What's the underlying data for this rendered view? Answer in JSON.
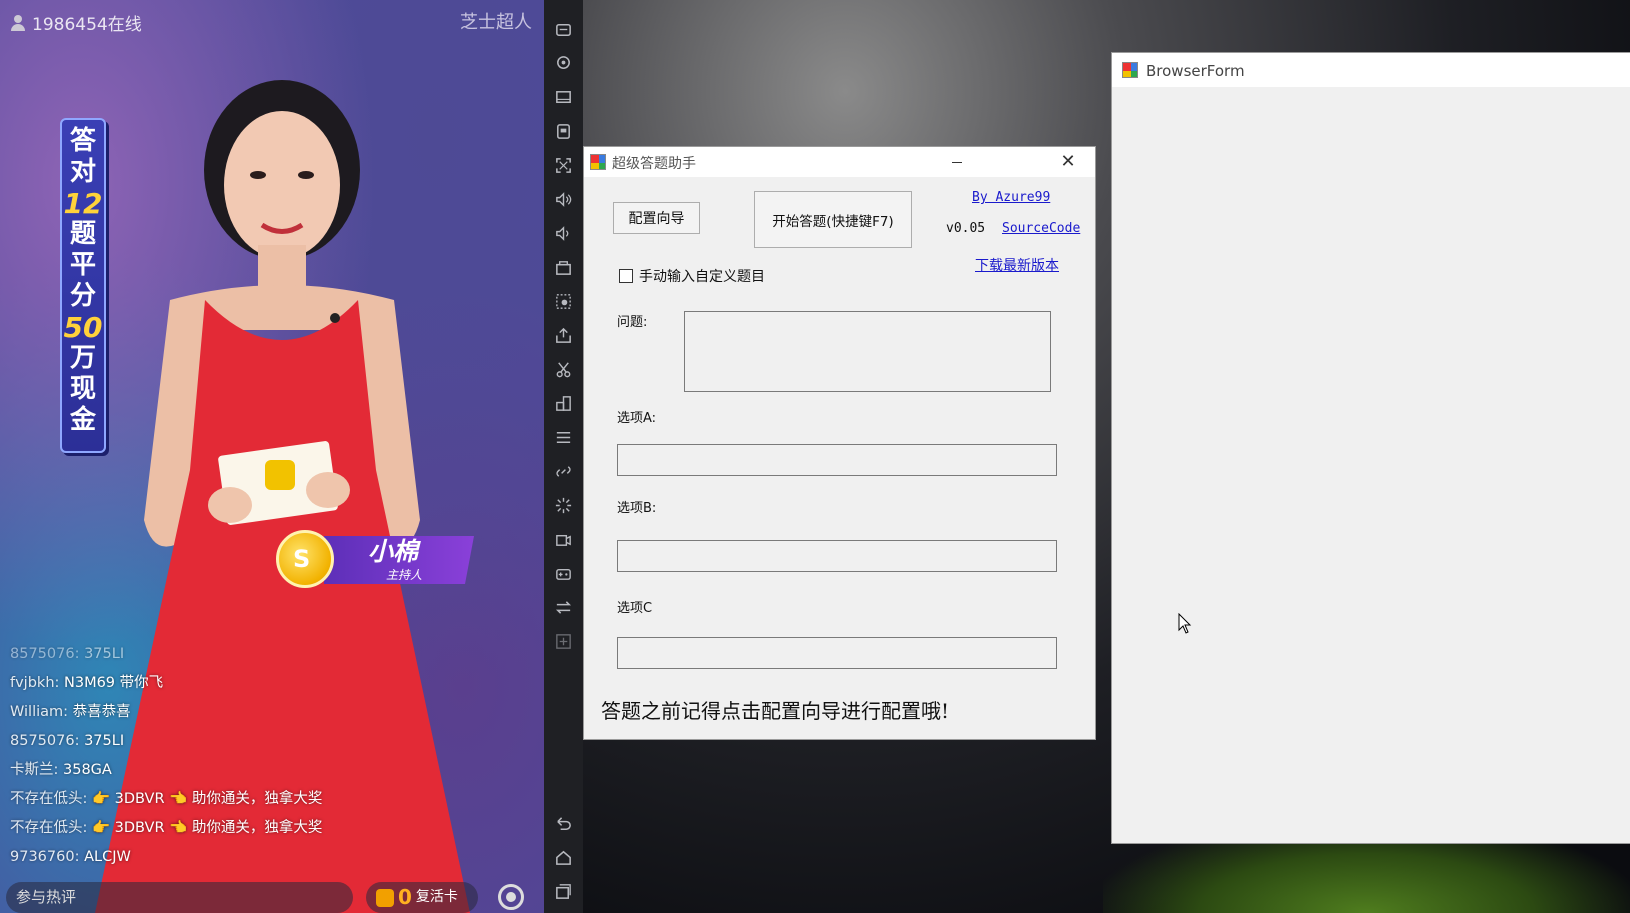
{
  "stream": {
    "viewers": "1986454在线",
    "brand": "芝士超人",
    "promo_chars": [
      "答",
      "对",
      "12",
      "题",
      "平",
      "分",
      "50",
      "万",
      "现",
      "金"
    ],
    "host_name": "小棉",
    "host_role": "主持人",
    "chat": [
      {
        "user": "8575076:",
        "msg": "375LI"
      },
      {
        "user": "fvjbkh:",
        "msg": "N3M69    带你飞"
      },
      {
        "user": "William:",
        "msg": "恭喜恭喜"
      },
      {
        "user": "8575076:",
        "msg": "375LI"
      },
      {
        "user": "卡斯兰:",
        "msg": "358GA"
      },
      {
        "user": "不存在低头:",
        "msg": "👉 3DBVR 👈 助你通关，独拿大奖"
      },
      {
        "user": "不存在低头:",
        "msg": "👉 3DBVR 👈 助你通关，独拿大奖"
      },
      {
        "user": "9736760:",
        "msg": "ALCJW"
      }
    ],
    "join_placeholder": "参与热评",
    "revive_count": "0",
    "revive_label": "复活卡"
  },
  "app": {
    "title": "超级答题助手",
    "wizard_button": "配置向导",
    "start_button": "开始答题(快捷键F7)",
    "author_link": "By Azure99",
    "version": "v0.05",
    "source_link": "SourceCode",
    "download_link": "下载最新版本",
    "custom_checkbox_label": "手动输入自定义题目",
    "custom_checked": false,
    "question_label": "问题:",
    "option_a_label": "选项A:",
    "option_b_label": "选项B:",
    "option_c_label": "选项C",
    "question_value": "",
    "option_a_value": "",
    "option_b_value": "",
    "option_c_value": "",
    "hint": "答题之前记得点击配置向导进行配置哦!"
  },
  "browser": {
    "title": "BrowserForm"
  }
}
